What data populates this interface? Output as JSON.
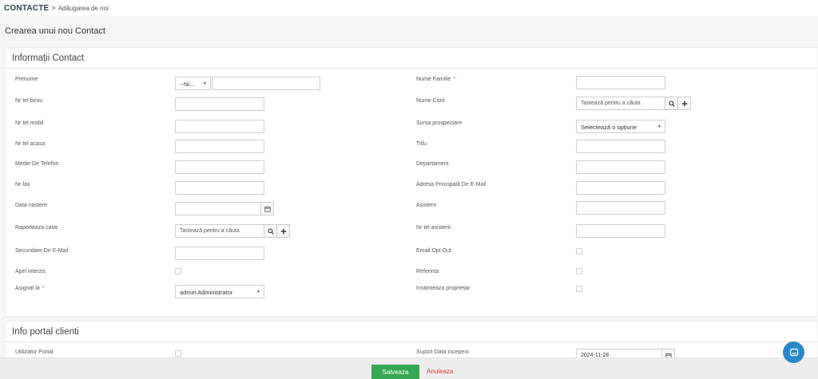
{
  "breadcrumb": {
    "module": "CONTACTE",
    "separator": ">",
    "current": "Adăugarea de noi"
  },
  "page_title": "Crearea unui nou Contact",
  "sections": {
    "contact_info": "Informații Contact",
    "portal_info": "Info portal clienti"
  },
  "left_fields": {
    "first_name": {
      "label": "Prenume",
      "salutation": "--Ni...",
      "value": ""
    },
    "office_phone": {
      "label": "Nr tel birou",
      "value": ""
    },
    "mobile_phone": {
      "label": "Nr tel mobil",
      "value": ""
    },
    "home_phone": {
      "label": "Nr tel acasa",
      "value": ""
    },
    "other_phone": {
      "label": "Medie De Telefon",
      "value": ""
    },
    "fax": {
      "label": "Nr fax",
      "value": ""
    },
    "birthdate": {
      "label": "Data nastere",
      "value": ""
    },
    "reports_to": {
      "label": "Raporteaza catre",
      "placeholder": "Tastează pentru a căuta"
    },
    "secondary_email": {
      "label": "Secundare De E-Mail",
      "value": ""
    },
    "do_not_call": {
      "label": "Apel interzis"
    },
    "assigned_to": {
      "label": "Asignat la",
      "required": "*",
      "value": "admin Administrator"
    }
  },
  "right_fields": {
    "last_name": {
      "label": "Nume Familie",
      "required": "*",
      "value": ""
    },
    "account_name": {
      "label": "Nume Cont",
      "placeholder": "Tastează pentru a căuta"
    },
    "lead_source": {
      "label": "Sursa prospectare",
      "value": "Selectează o opțiune"
    },
    "title": {
      "label": "Titlu",
      "value": ""
    },
    "department": {
      "label": "Departament",
      "value": ""
    },
    "primary_email": {
      "label": "Adresa Principală De E-Mail",
      "value": ""
    },
    "assistant": {
      "label": "Asistent",
      "value": ""
    },
    "assistant_phone": {
      "label": "Nr tel asistent",
      "value": ""
    },
    "email_opt_out": {
      "label": "Email Opt Out"
    },
    "reference": {
      "label": "Referinta"
    },
    "notify_owner": {
      "label": "Instiinteaza proprietar"
    }
  },
  "portal_fields": {
    "portal_user": {
      "label": "Utilizator Portal"
    },
    "support_start_date": {
      "label": "Suport Data Incepeni",
      "value": "2024-11-28"
    }
  },
  "footer": {
    "save_label": "Salveaza",
    "cancel_label": "Anuleaza"
  },
  "colors": {
    "save": "#36a852",
    "cancel": "#e53935",
    "required": "#e53935",
    "chat": "#2a87c8"
  },
  "icons": [
    "search-icon",
    "plus-icon",
    "calendar-icon",
    "caret-down-icon",
    "chat-icon"
  ]
}
